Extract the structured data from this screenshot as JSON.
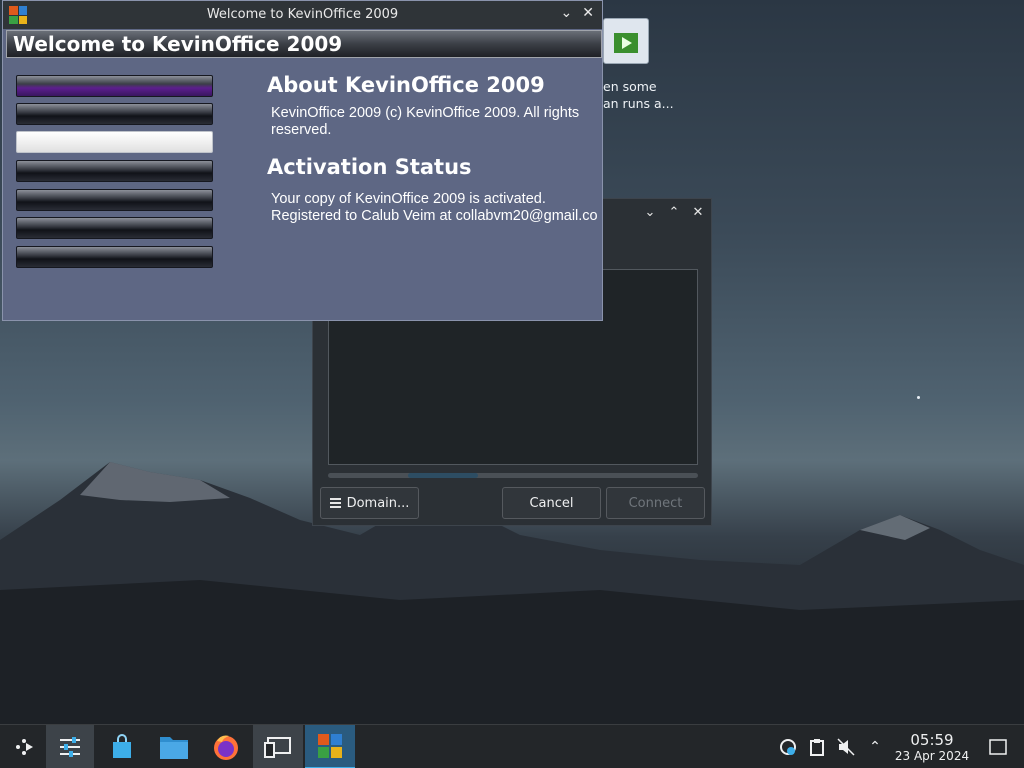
{
  "main_window": {
    "title": "Welcome to KevinOffice 2009",
    "banner": "Welcome to KevinOffice 2009",
    "about_heading": "About KevinOffice 2009",
    "about_text": "KevinOffice 2009 (c) KevinOffice 2009. All rights reserved.",
    "activation_heading": "Activation Status",
    "activation_line1": "Your copy of KevinOffice 2009 is activated.",
    "activation_line2": "Registered to Calub Veim at collabvm20@gmail.co",
    "nav_count": 7,
    "active_nav_index": 2
  },
  "desktop_icon": {
    "label_line1": "en some",
    "label_line2": "an runs a..."
  },
  "connect_dialog": {
    "domain_button": "Domain...",
    "cancel_button": "Cancel",
    "connect_button": "Connect"
  },
  "taskbar": {
    "time": "05:59",
    "date": "23 Apr 2024"
  },
  "colors": {
    "window_bg": "#5e6784",
    "taskbar_bg": "#232629",
    "accent": "#3daee9"
  }
}
